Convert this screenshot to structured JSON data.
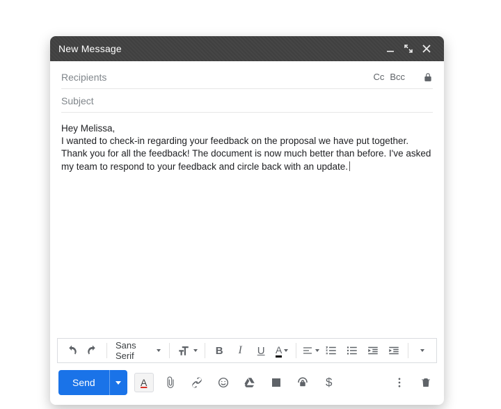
{
  "header": {
    "title": "New Message"
  },
  "fields": {
    "recipients_placeholder": "Recipients",
    "cc_label": "Cc",
    "bcc_label": "Bcc",
    "subject_placeholder": "Subject"
  },
  "body": {
    "greeting": "Hey Melissa,",
    "paragraph": "I wanted to check-in regarding your feedback on the proposal we have put together. Thank you for all the feedback! The document is now much better than before. I've asked my team to respond to your feedback and circle back with an update."
  },
  "format": {
    "font_family": "Sans Serif"
  },
  "footer": {
    "send_label": "Send"
  }
}
